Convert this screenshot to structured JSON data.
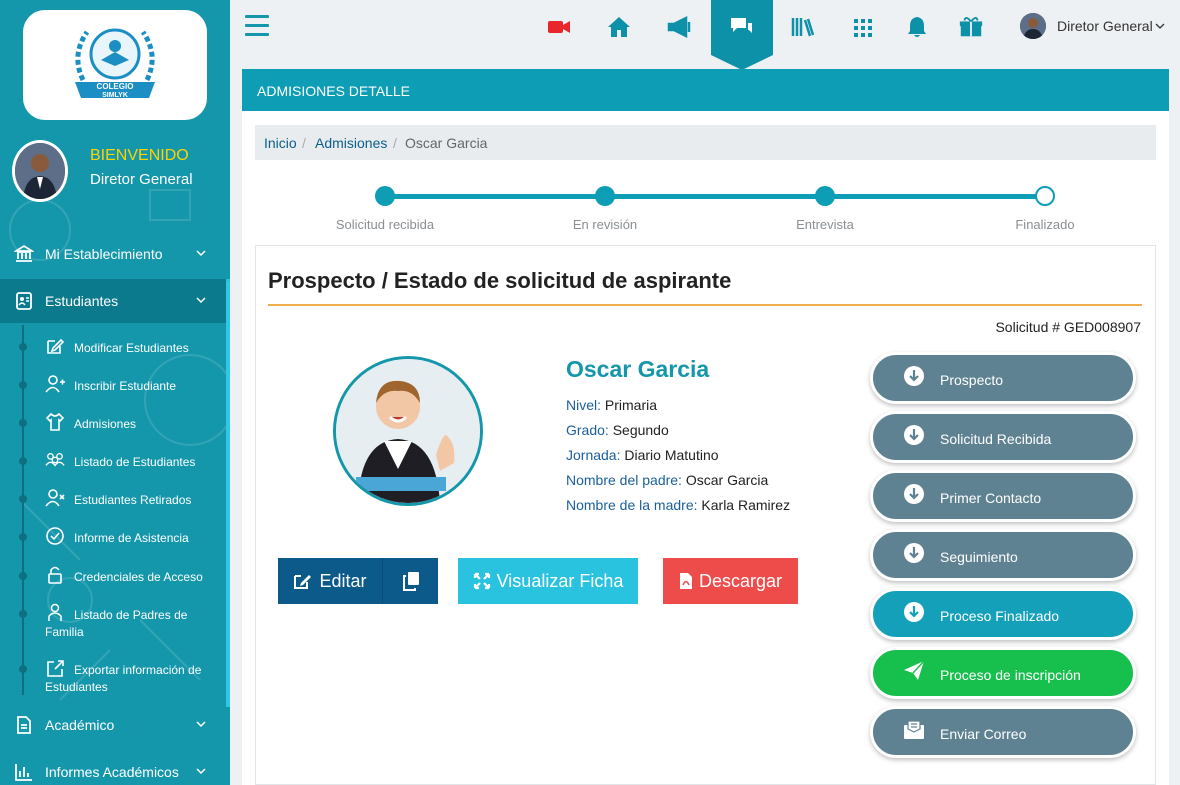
{
  "sidebar": {
    "logo_text": [
      "COLEGIO",
      "SIMLYK"
    ],
    "welcome": "BIENVENIDO",
    "role": "Diretor General",
    "sections": [
      {
        "label": "Mi Establecimiento",
        "icon": "building-icon"
      },
      {
        "label": "Estudiantes",
        "icon": "id-card-icon"
      },
      {
        "label": "Académico",
        "icon": "document-icon"
      },
      {
        "label": "Informes Académicos",
        "icon": "bar-chart-icon"
      }
    ],
    "sub_items": [
      {
        "label": "Modificar Estudiantes",
        "icon": "edit-icon"
      },
      {
        "label": "Inscribir Estudiante",
        "icon": "user-plus-icon"
      },
      {
        "label": "Admisiones",
        "icon": "shirt-icon"
      },
      {
        "label": "Listado de Estudiantes",
        "icon": "users-icon"
      },
      {
        "label": "Estudiantes Retirados",
        "icon": "user-x-icon"
      },
      {
        "label": "Informe de Asistencia",
        "icon": "check-circle-icon"
      },
      {
        "label": "Credenciales de Acceso",
        "icon": "lock-icon"
      },
      {
        "label": "Listado de Padres de",
        "label2": "Familia",
        "icon": "parents-icon"
      },
      {
        "label": "Exportar información de",
        "label2": "Estudiantes",
        "icon": "export-icon"
      }
    ]
  },
  "topbar": {
    "icons": [
      "video-icon",
      "home-icon",
      "megaphone-icon",
      "chat-icon",
      "books-icon",
      "grid-icon",
      "bell-icon",
      "gift-icon"
    ],
    "user_name": "Diretor General"
  },
  "main": {
    "header": "ADMISIONES DETALLE",
    "breadcrumb": [
      "Inicio",
      "Admisiones",
      "Oscar Garcia"
    ],
    "steps": [
      "Solicitud recibida",
      "En revisión",
      "Entrevista",
      "Finalizado"
    ],
    "panel_title": "Prospecto / Estado de solicitud de aspirante",
    "solicitud": "Solicitud # GED008907",
    "student": {
      "name": "Oscar Garcia",
      "fields": [
        {
          "k": "Nivel:",
          "v": "Primaria"
        },
        {
          "k": "Grado:",
          "v": "Segundo"
        },
        {
          "k": "Jornada:",
          "v": "Diario Matutino"
        },
        {
          "k": "Nombre del padre:",
          "v": "Oscar Garcia"
        },
        {
          "k": "Nombre de la madre:",
          "v": "Karla Ramirez"
        }
      ]
    },
    "buttons": {
      "edit": "Editar",
      "view": "Visualizar Ficha",
      "download": "Descargar"
    },
    "actions": [
      {
        "label": "Prospecto",
        "style": "gray"
      },
      {
        "label": "Solicitud Recibida",
        "style": "gray"
      },
      {
        "label": "Primer Contacto",
        "style": "gray"
      },
      {
        "label": "Seguimiento",
        "style": "gray"
      },
      {
        "label": "Proceso Finalizado",
        "style": "teal"
      },
      {
        "label": "Proceso de inscripción",
        "style": "green"
      },
      {
        "label": "Enviar Correo",
        "style": "gray"
      }
    ]
  },
  "colors": {
    "sidebar": "#1597ab",
    "accent": "#0d9db5",
    "rule": "#f0ad4e",
    "danger": "#ee4b4b",
    "success": "#17c04d"
  }
}
